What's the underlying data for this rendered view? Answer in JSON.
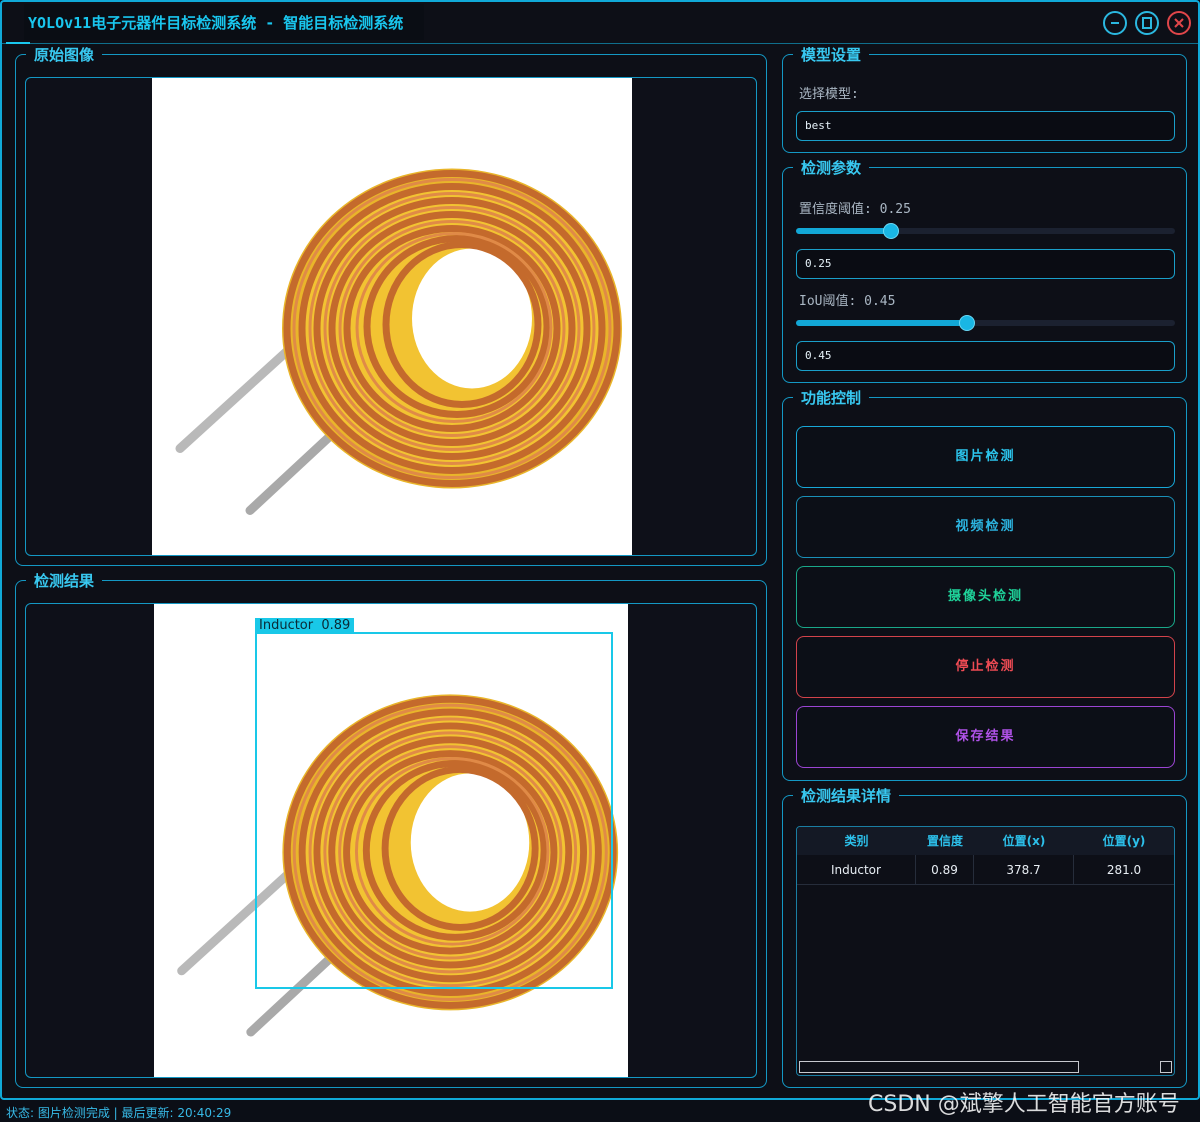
{
  "window": {
    "title": "YOLOv11电子元器件目标检测系统 - 智能目标检测系统"
  },
  "panels": {
    "original_image": "原始图像",
    "detection_result": "检测结果",
    "model_settings": "模型设置",
    "detection_params": "检测参数",
    "function_control": "功能控制",
    "result_details": "检测结果详情"
  },
  "model": {
    "select_label": "选择模型:",
    "selected": "best"
  },
  "params": {
    "conf_label": "置信度阈值: 0.25",
    "conf_value": "0.25",
    "conf_level": 0.25,
    "iou_label": "IoU阈值: 0.45",
    "iou_value": "0.45",
    "iou_level": 0.45
  },
  "buttons": {
    "image_detect": "图片检测",
    "video_detect": "视频检测",
    "camera_detect": "摄像头检测",
    "stop_detect": "停止检测",
    "save_result": "保存结果"
  },
  "detection_box": {
    "label": "Inductor  0.89"
  },
  "table": {
    "headers": [
      "类别",
      "置信度",
      "位置(x)",
      "位置(y)"
    ],
    "rows": [
      [
        "Inductor",
        "0.89",
        "378.7",
        "281.0"
      ]
    ]
  },
  "status": "状态: 图片检测完成 | 最后更新: 20:40:29",
  "watermark": "CSDN @斌擎人工智能官方账号",
  "colors": {
    "accent": "#19c6ee",
    "image_btn": "#2cc6ee",
    "video_btn": "#2cb4e0",
    "camera_btn": "#1fd39a",
    "stop_btn": "#ef4b54",
    "save_btn": "#b052e8"
  }
}
